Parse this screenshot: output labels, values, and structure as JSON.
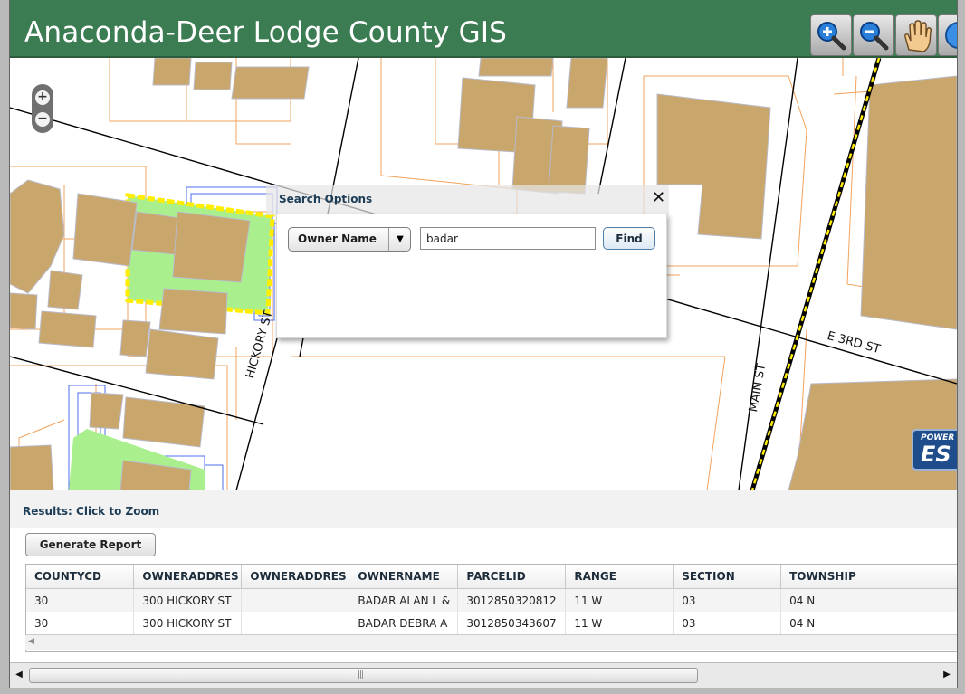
{
  "app": {
    "title": "Anaconda-Deer Lodge County GIS"
  },
  "toolbar": {
    "tools": [
      "zoom-in",
      "zoom-out",
      "pan",
      "globe"
    ]
  },
  "map": {
    "zoom_in_label": "+",
    "zoom_out_label": "−",
    "streets": {
      "hickory": "HICKORY ST",
      "main": "MAIN ST",
      "third": "E 3RD ST"
    },
    "esri": {
      "powered": "POWER",
      "logo": "ES"
    }
  },
  "search_dialog": {
    "title": "Search Options",
    "close_label": "✕",
    "field_selected": "Owner Name",
    "search_value": "badar",
    "find_label": "Find"
  },
  "results": {
    "title": "Results: Click to Zoom",
    "report_label": "Generate Report",
    "columns": [
      "COUNTYCD",
      "OWNERADDRES",
      "OWNERADDRES",
      "OWNERNAME",
      "PARCELID",
      "RANGE",
      "SECTION",
      "TOWNSHIP"
    ],
    "rows": [
      [
        "30",
        "300 HICKORY ST",
        "",
        "BADAR ALAN L &",
        "3012850320812",
        "11 W",
        "03",
        "04 N"
      ],
      [
        "30",
        "300 HICKORY ST",
        "",
        "BADAR DEBRA A",
        "3012850343607",
        "11 W",
        "03",
        "04 N"
      ]
    ]
  },
  "colors": {
    "header": "#3c7c53",
    "building": "#c9a76c",
    "parcel_line": "#f0a060",
    "selection": "#ffee00",
    "selected_fill": "#a5f08a",
    "accent_text": "#1d3d56"
  }
}
